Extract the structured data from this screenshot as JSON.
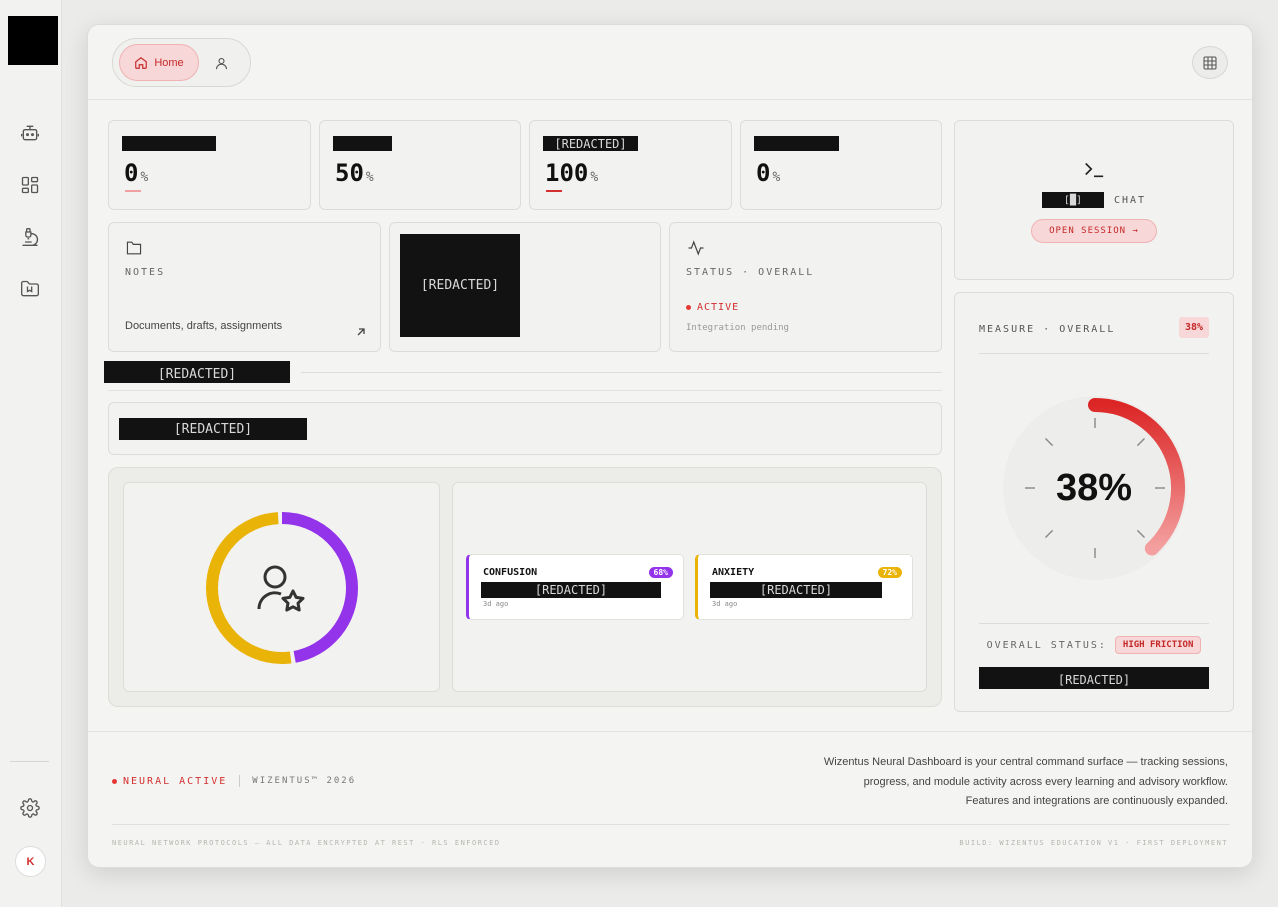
{
  "nav": {
    "tabs": [
      {
        "label": "Home",
        "active": true
      },
      {
        "label": "",
        "icon": "user-icon"
      }
    ],
    "sidebar_icons": [
      "bot-icon",
      "dashboard-icon",
      "microscope-icon",
      "folder-bookmark-icon"
    ],
    "avatar_initial": "K"
  },
  "stats": [
    {
      "label": "",
      "value": "0",
      "unit": "%",
      "bar_color": "#f0a0a0"
    },
    {
      "label": "",
      "value": "50",
      "unit": "%",
      "bar_color": ""
    },
    {
      "label": "[REDACTED]",
      "value": "100",
      "unit": "%",
      "bar_color": "#d32f2f"
    },
    {
      "label": "",
      "value": "0",
      "unit": "%",
      "bar_color": ""
    }
  ],
  "notes": {
    "label": "NOTES",
    "description": "Documents, drafts, assignments"
  },
  "media": {
    "label": "[REDACTED]"
  },
  "status": {
    "label": "STATUS · OVERALL",
    "state": "ACTIVE",
    "detail": "Integration pending"
  },
  "section_title": "[REDACTED]",
  "section_banner": "[REDACTED]",
  "modules": [
    {
      "title": "CONFUSION",
      "score": "68%",
      "text": "[REDACTED]",
      "time": "3d ago",
      "color": "#9333ea"
    },
    {
      "title": "ANXIETY",
      "score": "72%",
      "text": "[REDACTED]",
      "time": "3d ago",
      "color": "#eab308"
    }
  ],
  "donut": {
    "segments": [
      {
        "color": "#9333ea",
        "value": 48
      },
      {
        "color": "#eab308",
        "value": 52
      }
    ]
  },
  "chat": {
    "prefix": "[█]",
    "label": "CHAT",
    "button": "OPEN SESSION →"
  },
  "measure": {
    "label": "MEASURE · OVERALL",
    "badge": "38%",
    "value": "38%",
    "gauge_fraction": 0.38,
    "status_label": "OVERALL STATUS:",
    "status_value": "HIGH FRICTION",
    "footer_redacted": "[REDACTED]"
  },
  "footer": {
    "neural": "NEURAL ACTIVE",
    "brand": "WIZENTUS™ 2026",
    "description_lines": [
      "Wizentus Neural Dashboard is your central command surface — tracking sessions,",
      "progress, and module activity across every learning and advisory workflow.",
      "Features and integrations are continuously expanded."
    ],
    "security": "NEURAL NETWORK PROTOCOLS — ALL DATA ENCRYPTED AT REST · RLS ENFORCED",
    "build": "BUILD: WIZENTUS EDUCATION V1 · FIRST DEPLOYMENT"
  },
  "colors": {
    "accent": "#d32f2f",
    "purple": "#9333ea",
    "yellow": "#eab308"
  }
}
